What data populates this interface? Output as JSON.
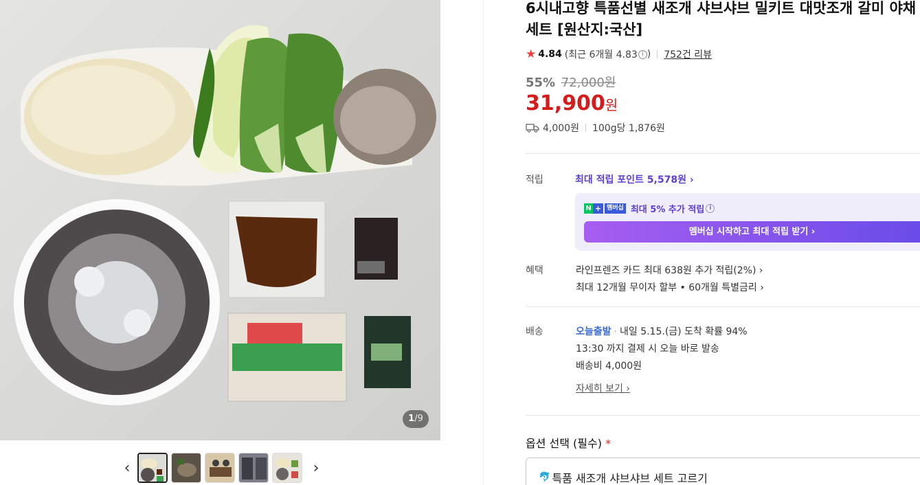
{
  "gallery": {
    "counter_current": "1",
    "counter_total": "/9",
    "prev_label": "‹",
    "next_label": "›",
    "thumbnail_count": 5
  },
  "product": {
    "title": "6시내고향 특품선별 새조개 샤브샤브 밀키트 대맛조개 갈미 야채세트 [원산지:국산]",
    "rating": "4.84",
    "rating_recent": "(최근 6개월 4.83",
    "rating_recent_close": ")",
    "review_count": "752건 리뷰",
    "discount_rate": "55%",
    "original_price": "72,000원",
    "price": "31,900",
    "price_unit": "원",
    "shipping_fee": "4,000원",
    "unit_price": "100g당 1,876원"
  },
  "points": {
    "label": "적립",
    "max_points": "최대 적립 포인트 5,578원 ›",
    "membership_badge": "멤버십",
    "membership_extra": "최대 5% 추가 적립",
    "membership_button": "멤버십 시작하고 최대 적립 받기 ›"
  },
  "benefits": {
    "label": "혜택",
    "line1": "라인프렌즈 카드 최대 638원 추가 적립(2%) ›",
    "line2": "최대 12개월 무이자 할부 • 60개월 특별금리 ›"
  },
  "delivery": {
    "label": "배송",
    "today_label": "오늘출발",
    "arrival": "내일 5.15.(금) 도착 확률 94%",
    "cutoff": "13:30 까지 결제 시 오늘 바로 발송",
    "fee": "배송비 4,000원",
    "detail_link": "자세히 보기 ›"
  },
  "options": {
    "label": "옵션 선택 (필수)",
    "required_mark": "*",
    "selected_value": "특품 새조개 샤브샤브 세트 고르기"
  },
  "colors": {
    "price_red": "#d51c1c",
    "point_purple": "#5b3ed6",
    "today_blue": "#3a6ad6"
  }
}
